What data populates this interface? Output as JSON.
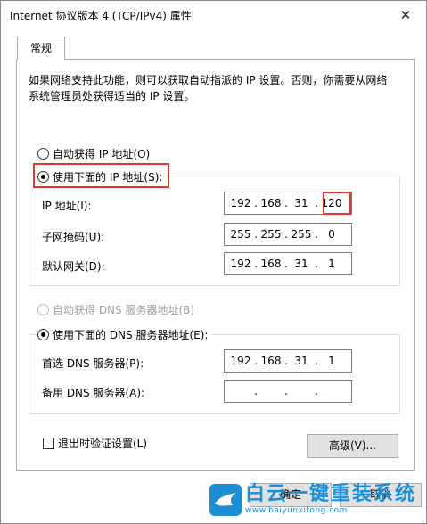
{
  "window": {
    "title": "Internet 协议版本 4 (TCP/IPv4) 属性",
    "close_glyph": "✕"
  },
  "tabs": [
    {
      "label": "常规",
      "active": true
    }
  ],
  "description": "如果网络支持此功能，则可以获取自动指派的 IP 设置。否则，你需要从网络系统管理员处获得适当的 IP 设置。",
  "ip_section": {
    "auto_label": "自动获得 IP 地址(O)",
    "manual_label": "使用下面的 IP 地址(S):",
    "selected": "manual",
    "fields": [
      {
        "label": "IP 地址(I):",
        "octets": [
          "192",
          "168",
          "31",
          "120"
        ]
      },
      {
        "label": "子网掩码(U):",
        "octets": [
          "255",
          "255",
          "255",
          "0"
        ]
      },
      {
        "label": "默认网关(D):",
        "octets": [
          "192",
          "168",
          "31",
          "1"
        ]
      }
    ]
  },
  "dns_section": {
    "auto_label": "自动获得 DNS 服务器地址(B)",
    "manual_label": "使用下面的 DNS 服务器地址(E):",
    "selected": "manual",
    "fields": [
      {
        "label": "首选 DNS 服务器(P):",
        "octets": [
          "192",
          "168",
          "31",
          "1"
        ]
      },
      {
        "label": "备用 DNS 服务器(A):",
        "octets": [
          "",
          "",
          "",
          ""
        ]
      }
    ]
  },
  "validate_on_exit": {
    "label": "退出时验证设置(L)",
    "checked": false
  },
  "buttons": {
    "advanced": "高级(V)...",
    "ok": "确定",
    "cancel": "取消"
  },
  "watermark": {
    "title": "白云一键重装系统",
    "url": "www.baiyunxitong.com"
  },
  "colors": {
    "highlight": "#e8322e",
    "brand": "#1a8fd6"
  }
}
